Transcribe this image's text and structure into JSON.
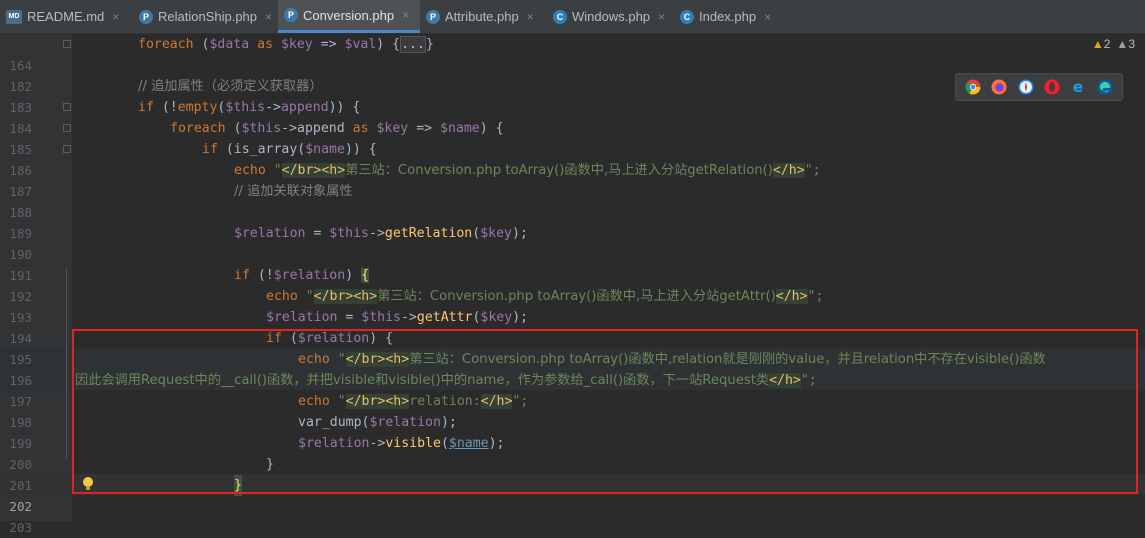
{
  "tabs": [
    {
      "label": "README.md",
      "icon": "markdown-file-icon",
      "active": false
    },
    {
      "label": "RelationShip.php",
      "icon": "php-file-icon",
      "active": false
    },
    {
      "label": "Conversion.php",
      "icon": "php-file-icon",
      "active": true
    },
    {
      "label": "Attribute.php",
      "icon": "php-file-icon",
      "active": false
    },
    {
      "label": "Windows.php",
      "icon": "php-class-icon",
      "active": false
    },
    {
      "label": "Index.php",
      "icon": "php-class-icon",
      "active": false
    }
  ],
  "inspections": {
    "warnings": "2",
    "weak_warnings": "3"
  },
  "lines": [
    "164",
    "182",
    "183",
    "184",
    "185",
    "186",
    "187",
    "188",
    "189",
    "190",
    "191",
    "192",
    "193",
    "194",
    "195",
    "196",
    "197",
    "198",
    "199",
    "200",
    "201",
    "202",
    "203"
  ],
  "code": {
    "l164": {
      "kw": "foreach",
      "a": " (",
      "v1": "$data",
      "b": " ",
      "kw2": "as",
      "c": " ",
      "v2": "$key",
      "d": " => ",
      "v3": "$val",
      "e": ") {",
      "fold": "...",
      "f": "}"
    },
    "l183": "// 追加属性（必须定义获取器）",
    "l184": {
      "kw": "if",
      "a": " (!",
      "fn": "empty",
      "b": "(",
      "v": "$this",
      "c": "->",
      "p": "append",
      "d": ")) {"
    },
    "l185": {
      "kw": "foreach",
      "a": " (",
      "v": "$this",
      "b": "->append ",
      "kw2": "as",
      "c": " ",
      "v2": "$key",
      "d": " => ",
      "v3": "$name",
      "e": ") {"
    },
    "l186": {
      "kw": "if",
      "a": " (is_array(",
      "v": "$name",
      "b": ")) {"
    },
    "l187": {
      "kw": "echo",
      "q1": " \"",
      "t1": "</br><h>",
      "s": "第三站：Conversion.php toArray()函数中,马上进入分站getRelation()",
      "t2": "</h>",
      "q2": "\";"
    },
    "l188": "// 追加关联对象属性",
    "l190": {
      "v": "$relation",
      "a": " = ",
      "v2": "$this",
      "b": "->",
      "fn": "getRelation",
      "c": "(",
      "v3": "$key",
      "d": ");"
    },
    "l192": {
      "kw": "if",
      "a": " (!",
      "v": "$relation",
      "b": ") ",
      "br": "{"
    },
    "l193": {
      "kw": "echo",
      "q1": " \"",
      "t1": "</br><h>",
      "s": "第三站：Conversion.php toArray()函数中,马上进入分站getAttr()",
      "t2": "</h>",
      "q2": "\";"
    },
    "l194": {
      "v": "$relation",
      "a": " = ",
      "v2": "$this",
      "b": "->",
      "fn": "getAttr",
      "c": "(",
      "v3": "$key",
      "d": ");"
    },
    "l195": {
      "kw": "if",
      "a": " (",
      "v": "$relation",
      "b": ") {"
    },
    "l196": {
      "kw": "echo",
      "q1": " \"",
      "t1": "</br><h>",
      "s": "第三站：Conversion.php toArray()函数中,relation就是刚刚的value，并且relation中不存在visible()函数"
    },
    "l197": {
      "s": "因此会调用Request中的__call()函数，并把visible和visible()中的name，作为参数给_call()函数，下一站Request类",
      "t2": "</h>",
      "q2": "\";"
    },
    "l198": {
      "kw": "echo",
      "q1": " \"",
      "t1": "</br><h>",
      "s": "relation:",
      "t2": "</h>",
      "q2": "\";"
    },
    "l199": {
      "fn": "var_dump",
      "a": "(",
      "v": "$relation",
      "b": ");"
    },
    "l200": {
      "v": "$relation",
      "a": "->",
      "fn": "visible",
      "b": "(",
      "v2": "$name",
      "c": ");"
    },
    "l201": "}",
    "l202": "}"
  },
  "colors": {
    "highlight_box": "#e02424",
    "accent": "#4a88c7"
  }
}
